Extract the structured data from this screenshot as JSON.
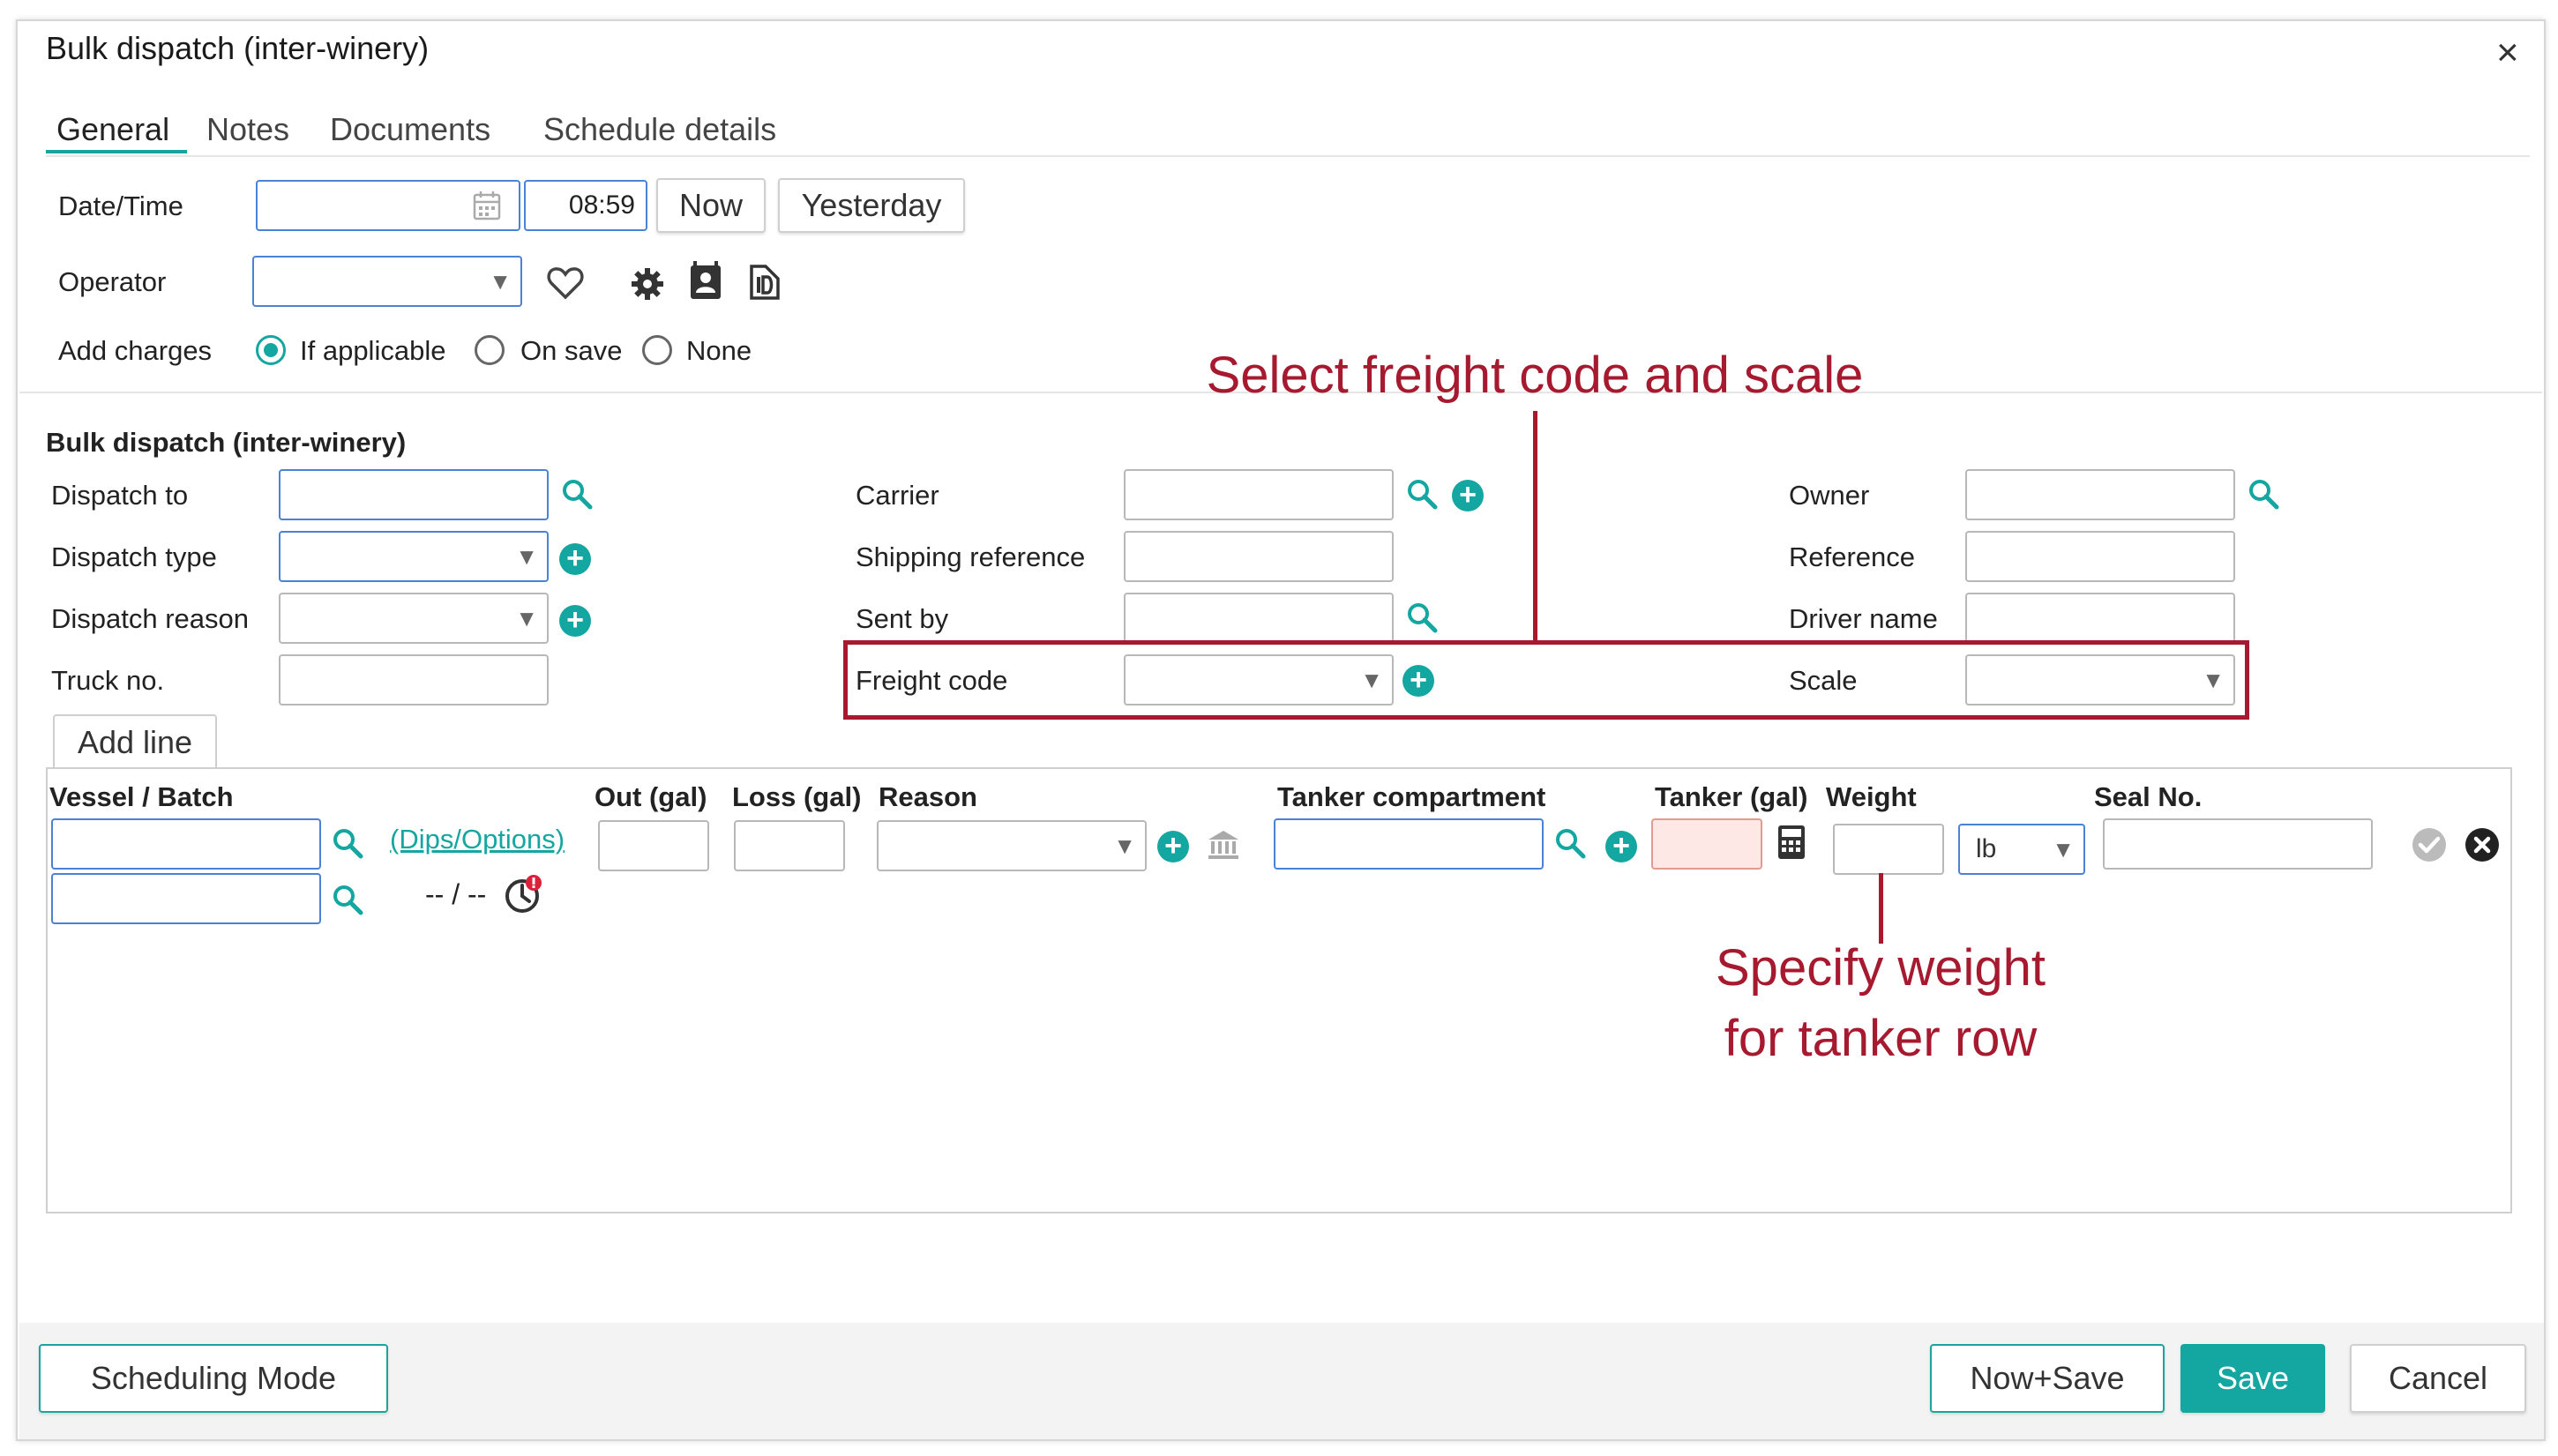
{
  "dialog": {
    "title": "Bulk dispatch (inter-winery)",
    "close_label": "×"
  },
  "tabs": [
    "General",
    "Notes",
    "Documents",
    "Schedule details"
  ],
  "general": {
    "datetime_label": "Date/Time",
    "date_value": "",
    "time_value": "08:59",
    "now_button": "Now",
    "yesterday_button": "Yesterday",
    "operator_label": "Operator",
    "add_charges_label": "Add charges",
    "charges_options": [
      "If applicable",
      "On save",
      "None"
    ],
    "charges_selected": "If applicable"
  },
  "section": {
    "title": "Bulk dispatch (inter-winery)",
    "left": [
      "Dispatch to",
      "Dispatch type",
      "Dispatch reason",
      "Truck no."
    ],
    "middle": [
      "Carrier",
      "Shipping reference",
      "Sent by",
      "Freight code"
    ],
    "right": [
      "Owner",
      "Reference",
      "Driver name",
      "Scale"
    ]
  },
  "grid": {
    "add_line_button": "Add line",
    "columns": [
      "Vessel / Batch",
      "Out (gal)",
      "Loss (gal)",
      "Reason",
      "Tanker compartment",
      "Tanker (gal)",
      "Weight",
      "Seal No."
    ],
    "dips_link": "(Dips/Options)",
    "date_placeholder": "-- / --",
    "weight_unit": "lb"
  },
  "annotations": {
    "freight_scale": "Select freight code and scale",
    "weight_line1": "Specify weight",
    "weight_line2": "for tanker row"
  },
  "footer": {
    "scheduling_mode": "Scheduling Mode",
    "now_save": "Now+Save",
    "save": "Save",
    "cancel": "Cancel"
  },
  "colors": {
    "accent": "#14a6a0",
    "annotation": "#a6192e"
  }
}
